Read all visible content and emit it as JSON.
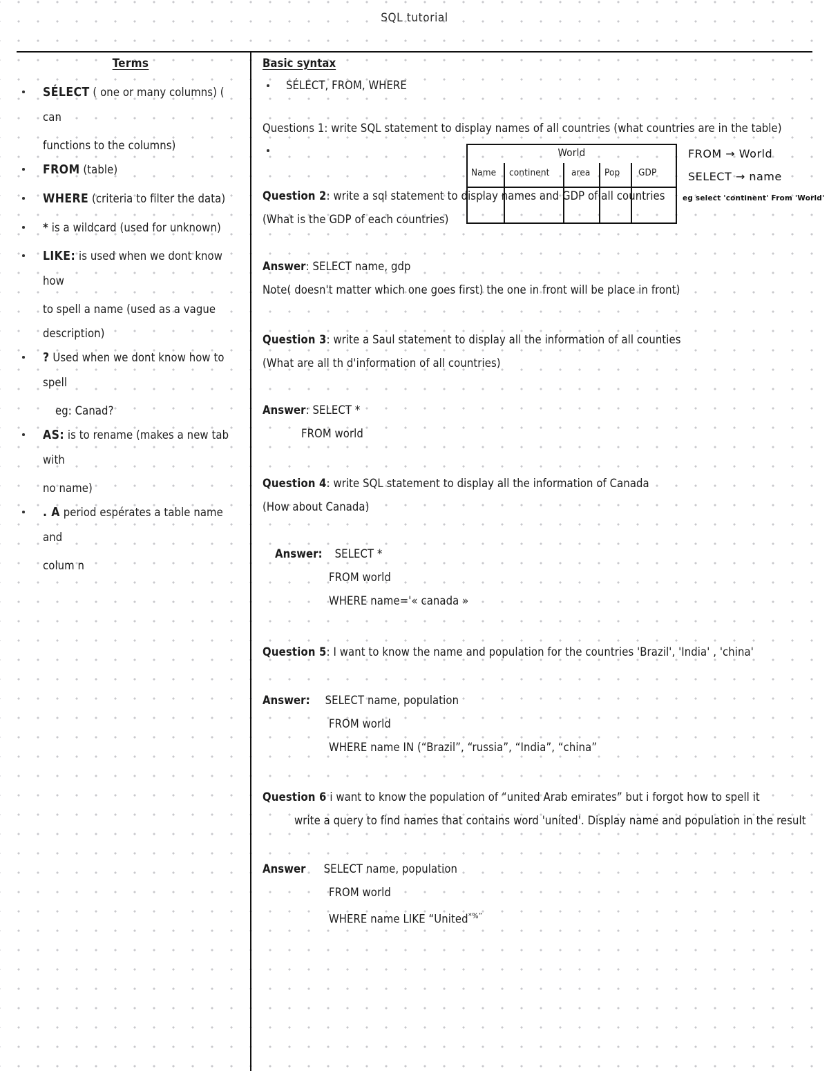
{
  "header": {
    "title": "SQL tutorial"
  },
  "left": {
    "title": "Terms",
    "terms": [
      {
        "keyword": "SÉLECT",
        "rest": "( one or many columns) ( can",
        "cont": [
          "functions to the columns)"
        ]
      },
      {
        "keyword": "FROM",
        "rest": "(table)",
        "cont": []
      },
      {
        "keyword": "WHERE",
        "rest": "(criteria to filter the data)",
        "cont": []
      },
      {
        "keyword": "*",
        "rest": "is a wildcard (used for unknown)",
        "cont": []
      },
      {
        "keyword": "LIKE:",
        "rest": "is used when we dont know how",
        "cont": [
          "to spell a name (used as a vague",
          "description)"
        ]
      },
      {
        "keyword": "?",
        "rest": "Used when we dont know how to spell",
        "cont": [
          "eg: Canad?"
        ]
      },
      {
        "keyword": "AS:",
        "rest": "is to rename (makes a new tab with",
        "cont": [
          "no name)"
        ]
      },
      {
        "keyword": ". A",
        "rest": "period espérates a table name and",
        "cont": [
          "colum n"
        ]
      }
    ]
  },
  "right": {
    "section_title": "Basic syntax",
    "syntax_bullet": "SÉLECT, FROM, WHERE",
    "question1": {
      "text": "Questions 1: write SQL statement to display names of all countries (what countries are in the table)"
    },
    "world_table": {
      "title": "World",
      "columns": [
        "Name",
        "continent",
        "area",
        "Pop",
        "GDP"
      ]
    },
    "annotations": [
      "FROM  → World",
      "SELECT  → name",
      "eg  select 'continent'  From 'World'"
    ],
    "questions": [
      {
        "label": "Question 2",
        "text": ": write a sql statement to display names and GDP of all countries",
        "sub": "(What is the GDP of each countries)",
        "answer_label": "Answer",
        "answer_first": ": SELECT name, gdp",
        "answer_lines": [],
        "note": "Note( doesn't matter which one goes first) the one in front will be place in front)"
      },
      {
        "label": "Question 3",
        "text": ": write a Saul statement to display all the information of all counties",
        "sub": "(What are all th d'information of all countries)",
        "answer_label": "Answer",
        "answer_first": ": SELECT *",
        "answer_lines": [
          "FROM world"
        ],
        "note": ""
      },
      {
        "label": "Question 4",
        "text": ": write SQL statement to display all the information of Canada",
        "sub": "(How about Canada)",
        "answer_label": "Answer:",
        "answer_first": "SELECT *",
        "answer_lines": [
          "FROM world",
          "WHERE name='« canada »"
        ],
        "note": ""
      },
      {
        "label": "Question 5",
        "text": ": I want to know the name and population for the countries 'Brazil', 'India' , 'china'",
        "sub": "",
        "answer_label": "Answer:",
        "answer_first": "SELECT  name, population",
        "answer_lines": [
          "FROM world",
          "WHERE name IN (“Brazil”, “russia”, “India”, “china”"
        ],
        "note": ""
      },
      {
        "label": "Question 6",
        "text": " i want to know the population of “united Arab emirates” but i forgot how to spell it",
        "sub": "write a query to find names that contains word 'united'. Display name and population in the result",
        "answer_label": "Answer",
        "answer_first": "SELECT name, population",
        "answer_lines": [
          "FROM world"
        ],
        "like_line_prefix": "WHERE name LIKE “United",
        "like_line_sup": "*%”",
        "note": ""
      }
    ]
  }
}
